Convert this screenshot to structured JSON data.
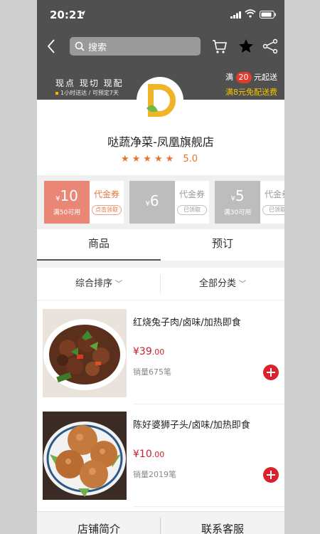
{
  "status_bar": {
    "time": "20:21"
  },
  "search": {
    "placeholder": "搜索"
  },
  "header": {
    "slogan": "现点 现切 现配",
    "delivery_note": "1小时送达 / 可预定7天",
    "min_order_prefix": "满",
    "min_order_amount": "20",
    "min_order_suffix": "元起送",
    "free_shipping": "满8元免配送费"
  },
  "shop": {
    "name": "哒蔬净菜-凤凰旗舰店",
    "stars": "★★★★★",
    "score": "5.0",
    "logo_letter": "D"
  },
  "coupons": [
    {
      "symbol": "¥",
      "amount": "10",
      "condition": "满50可用",
      "title": "代金券",
      "action": "点击领取",
      "state": "active"
    },
    {
      "symbol": "¥",
      "amount": "6",
      "condition": "",
      "title": "代金券",
      "action": "已领取",
      "state": "claimed"
    },
    {
      "symbol": "¥",
      "amount": "5",
      "condition": "满30可用",
      "title": "代金券",
      "action": "已领取",
      "state": "claimed"
    }
  ],
  "tabs": [
    {
      "label": "商品"
    },
    {
      "label": "预订"
    }
  ],
  "filters": [
    {
      "label": "综合排序"
    },
    {
      "label": "全部分类"
    }
  ],
  "products": [
    {
      "name": "红烧兔子肉/卤味/加热即食",
      "price_symbol": "¥",
      "price_int": "39",
      "price_dec": ".00",
      "sales": "销量675笔"
    },
    {
      "name": "陈好婆狮子头/卤味/加热即食",
      "price_symbol": "¥",
      "price_int": "10",
      "price_dec": ".00",
      "sales": "销量2019笔"
    }
  ],
  "bottom_bar": {
    "intro": "店铺简介",
    "contact": "联系客服"
  },
  "colors": {
    "header_bg": "#505050",
    "accent_orange": "#e7742f",
    "price_red": "#c8202e",
    "coupon_active": "#e98676",
    "logo_yellow": "#f0b428"
  }
}
